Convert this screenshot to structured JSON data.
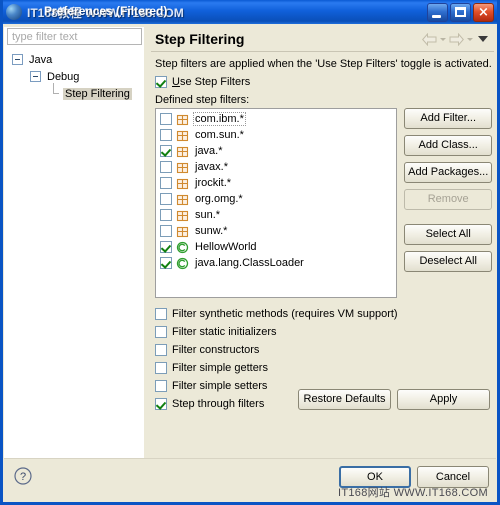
{
  "window": {
    "title": "Preferences (Filtered)",
    "watermark_title": "IT168教程 WWW.IT168.COM",
    "watermark_bottom": "IT168网站 WWW.IT168.COM",
    "minimize_label": "Minimize",
    "maximize_label": "Maximize",
    "close_label": "×",
    "titlebar_color": "#1060da"
  },
  "sidebar": {
    "filter": {
      "placeholder": "type filter text",
      "value": ""
    },
    "tree": [
      {
        "label": "Java",
        "level": 1,
        "expanded": true,
        "selected": false
      },
      {
        "label": "Debug",
        "level": 2,
        "expanded": true,
        "selected": false
      },
      {
        "label": "Step Filtering",
        "level": 3,
        "expanded": false,
        "selected": true
      }
    ]
  },
  "panel": {
    "title": "Step Filtering",
    "nav": {
      "back_label": "Back",
      "forward_label": "Forward",
      "menu_label": "View Menu"
    },
    "description": "Step filters are applied when the 'Use Step Filters' toggle is activated.",
    "use_step_filters": {
      "label": "Use Step Filters",
      "mnemonic": "U",
      "checked": true
    },
    "defined_label": "Defined step filters:",
    "filters": [
      {
        "label": "com.ibm.*",
        "checked": false,
        "icon": "package-icon",
        "focused": true
      },
      {
        "label": "com.sun.*",
        "checked": false,
        "icon": "package-icon",
        "focused": false
      },
      {
        "label": "java.*",
        "checked": true,
        "icon": "package-icon",
        "focused": false
      },
      {
        "label": "javax.*",
        "checked": false,
        "icon": "package-icon",
        "focused": false
      },
      {
        "label": "jrockit.*",
        "checked": false,
        "icon": "package-icon",
        "focused": false
      },
      {
        "label": "org.omg.*",
        "checked": false,
        "icon": "package-icon",
        "focused": false
      },
      {
        "label": "sun.*",
        "checked": false,
        "icon": "package-icon",
        "focused": false
      },
      {
        "label": "sunw.*",
        "checked": false,
        "icon": "package-icon",
        "focused": false
      },
      {
        "label": "HellowWorld",
        "checked": true,
        "icon": "class-icon",
        "focused": false
      },
      {
        "label": "java.lang.ClassLoader",
        "checked": true,
        "icon": "class-icon",
        "focused": false
      }
    ],
    "list_buttons": [
      {
        "label": "Add Filter...",
        "enabled": true
      },
      {
        "label": "Add Class...",
        "enabled": true
      },
      {
        "label": "Add Packages...",
        "enabled": true
      },
      {
        "label": "Remove",
        "enabled": false
      },
      {
        "label": "Select All",
        "enabled": true
      },
      {
        "label": "Deselect All",
        "enabled": true
      }
    ],
    "options": [
      {
        "label": "Filter synthetic methods (requires VM support)",
        "checked": false
      },
      {
        "label": "Filter static initializers",
        "checked": false
      },
      {
        "label": "Filter constructors",
        "checked": false
      },
      {
        "label": "Filter simple getters",
        "checked": false
      },
      {
        "label": "Filter simple setters",
        "checked": false
      },
      {
        "label": "Step through filters",
        "checked": true
      }
    ],
    "restore_defaults_label": "Restore Defaults",
    "apply_label": "Apply"
  },
  "footer": {
    "help_label": "?",
    "ok_label": "OK",
    "cancel_label": "Cancel"
  }
}
